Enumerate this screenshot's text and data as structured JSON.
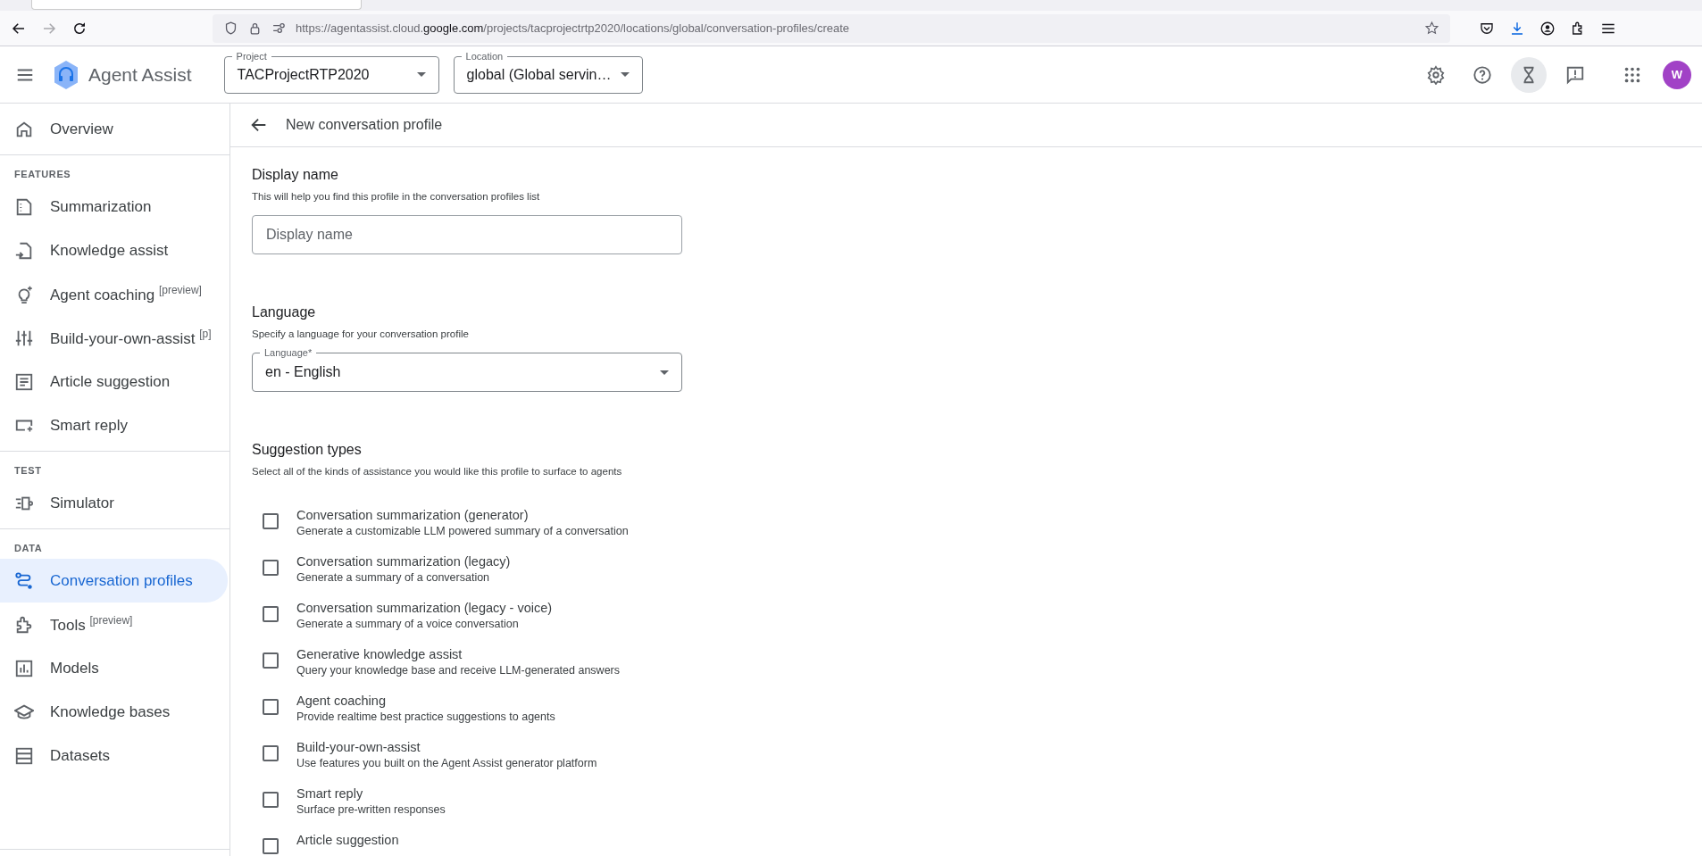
{
  "browser": {
    "back": {
      "disabled": false
    },
    "forward": {
      "disabled": true
    },
    "url": "https://agentassist.cloud.**google.com**/projects/tacprojectrtp2020/locations/global/conversation-profiles/create"
  },
  "header": {
    "title": "Agent Assist",
    "project": {
      "label": "Project",
      "value": "TACProjectRTP2020"
    },
    "location": {
      "label": "Location",
      "value": "global (Global servin…"
    },
    "toolbar": [
      {
        "kind": "settings",
        "selected": false
      },
      {
        "kind": "help",
        "selected": false
      },
      {
        "kind": "hourglass",
        "selected": true
      },
      {
        "kind": "feedback",
        "selected": false
      },
      {
        "kind": "apps",
        "selected": false
      }
    ],
    "avatar": "W"
  },
  "sidebar": {
    "sections": [
      {
        "items": [
          {
            "kind": "home",
            "label": "Overview",
            "selected": false
          }
        ]
      },
      {
        "heading": "FEATURES",
        "items": [
          {
            "kind": "summary",
            "label": "Summarization",
            "selected": false
          },
          {
            "kind": "knowledge",
            "label": "Knowledge assist",
            "selected": false
          },
          {
            "kind": "bulb",
            "label": "Agent coaching $^{[preview]}$",
            "selected": false
          },
          {
            "kind": "tune",
            "label": "Build-your-own-assist $^{[p]}$",
            "selected": false
          },
          {
            "kind": "article",
            "label": "Article suggestion",
            "selected": false
          },
          {
            "kind": "reply",
            "label": "Smart reply",
            "selected": false
          }
        ]
      },
      {
        "heading": "TEST",
        "items": [
          {
            "kind": "simulator",
            "label": "Simulator",
            "selected": false
          }
        ]
      },
      {
        "heading": "DATA",
        "items": [
          {
            "kind": "route",
            "label": "Conversation profiles",
            "selected": true
          },
          {
            "kind": "puzzle",
            "label": "Tools $^{[preview]}$",
            "selected": false
          },
          {
            "kind": "chart",
            "label": "Models",
            "selected": false
          },
          {
            "kind": "school",
            "label": "Knowledge bases",
            "selected": false
          },
          {
            "kind": "list",
            "label": "Datasets",
            "selected": false
          }
        ]
      }
    ]
  },
  "page": {
    "title": "New conversation profile",
    "display_name": {
      "heading": "Display name",
      "description": "This will help you find this profile in the conversation profiles list",
      "field": {
        "placeholder": "Display name"
      }
    },
    "language": {
      "heading": "Language",
      "description": "Specify a language for your conversation profile",
      "select": {
        "label": "Language*",
        "value": "en - English"
      }
    },
    "suggestion_types": {
      "heading": "Suggestion types",
      "description": "Select all of the kinds of assistance you would like this profile to surface to agents",
      "options": [
        {
          "title": "Conversation summarization (generator)",
          "description": "Generate a customizable LLM powered summary of a conversation",
          "checked": false
        },
        {
          "title": "Conversation summarization (legacy)",
          "description": "Generate a summary of a conversation",
          "checked": false
        },
        {
          "title": "Conversation summarization (legacy - voice)",
          "description": "Generate a summary of a voice conversation",
          "checked": false
        },
        {
          "title": "Generative knowledge assist",
          "description": "Query your knowledge base and receive LLM-generated answers",
          "checked": false
        },
        {
          "title": "Agent coaching",
          "description": "Provide realtime best practice suggestions to agents",
          "checked": false
        },
        {
          "title": "Build-your-own-assist",
          "description": "Use features you built on the Agent Assist generator platform",
          "checked": false
        },
        {
          "title": "Smart reply",
          "description": "Surface pre-written responses",
          "checked": false
        },
        {
          "title": "Article suggestion",
          "checked": false
        }
      ]
    }
  }
}
